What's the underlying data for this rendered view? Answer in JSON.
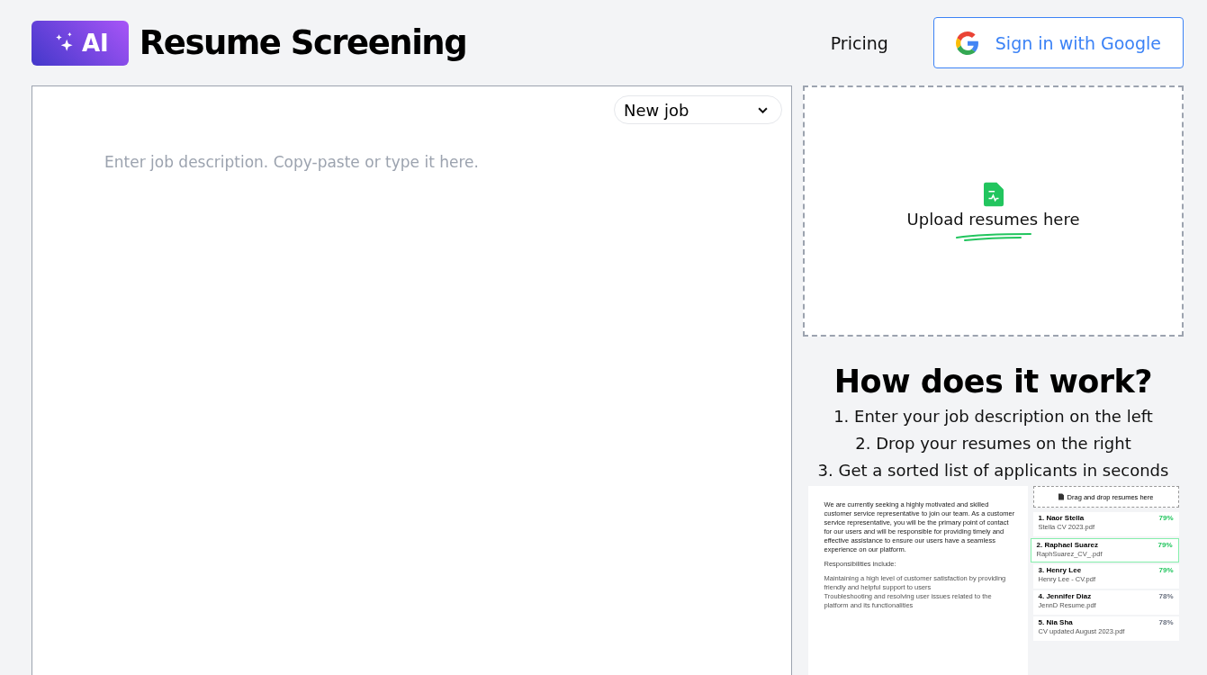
{
  "logo": {
    "badge": "AI",
    "title": "Resume Screening"
  },
  "nav": {
    "link": "Pricing",
    "signin": "Sign in with Google"
  },
  "job": {
    "select": "New job",
    "placeholder": "Enter job description. Copy-paste or type it here."
  },
  "upload": {
    "label": "Upload resumes here"
  },
  "how": {
    "title": "How does it work?",
    "steps": [
      "1. Enter your job description on the left",
      "2. Drop your resumes on the right",
      "3. Get a sorted list of applicants in seconds"
    ]
  },
  "preview": {
    "description": "We are currently seeking a highly motivated and skilled customer service representative to join our team. As a customer service representative, you will be the primary point of contact for our users and will be responsible for providing timely and effective assistance to ensure our users have a seamless experience on our platform.",
    "heading": "Responsibilities include:",
    "items": [
      "Maintaining a high level of customer satisfaction by providing friendly and helpful support to users",
      "Troubleshooting and resolving user issues related to the platform and its functionalities"
    ],
    "drop": "Drag and drop resumes here",
    "results": [
      {
        "name": "1. Naor Stella",
        "file": "Stella CV 2023.pdf",
        "score": "79%",
        "color": "#22c55e",
        "selected": false
      },
      {
        "name": "2. Raphael Suarez",
        "file": "RaphSuarez_CV_.pdf",
        "score": "79%",
        "color": "#22c55e",
        "selected": true
      },
      {
        "name": "3. Henry Lee",
        "file": "Henry Lee - CV.pdf",
        "score": "79%",
        "color": "#22c55e",
        "selected": false
      },
      {
        "name": "4. Jennifer Diaz",
        "file": "JennD Resume.pdf",
        "score": "78%",
        "color": "#6b7280",
        "selected": false
      },
      {
        "name": "5. Nia Sha",
        "file": "CV updated August 2023.pdf",
        "score": "78%",
        "color": "#6b7280",
        "selected": false
      }
    ]
  }
}
